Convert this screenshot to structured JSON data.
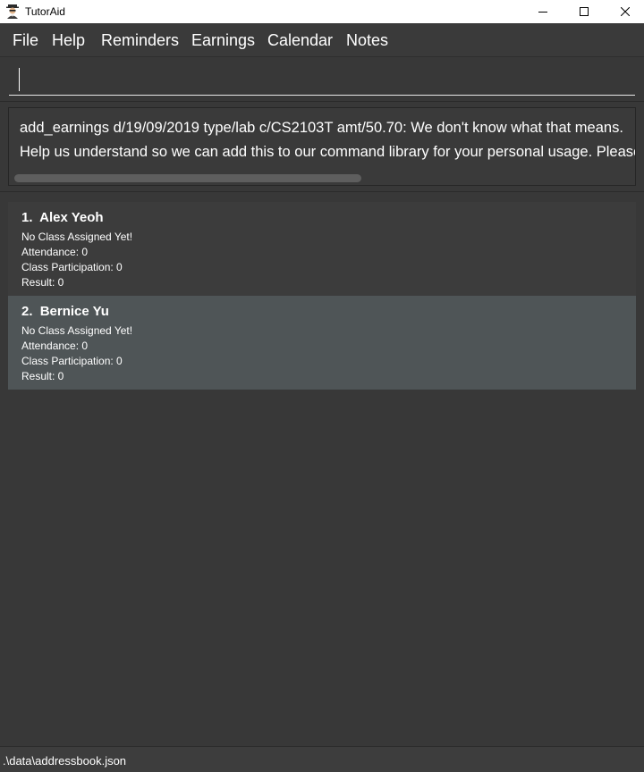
{
  "window": {
    "title": "TutorAid",
    "icon": "tutor-avatar-icon",
    "controls": [
      "minimize-icon",
      "maximize-icon",
      "close-icon"
    ]
  },
  "menu": {
    "items": [
      {
        "label": "File"
      },
      {
        "label": "Help"
      },
      {
        "label": "Reminders"
      },
      {
        "label": "Earnings"
      },
      {
        "label": "Calendar"
      },
      {
        "label": "Notes"
      }
    ]
  },
  "command": {
    "value": "",
    "placeholder": ""
  },
  "result": {
    "line1": "add_earnings d/19/09/2019 type/lab c/CS2103T amt/50.70: We don't know what that means.",
    "line2": "Help us understand so we can add this to our command library for your personal usage. Please"
  },
  "persons": [
    {
      "index": "1.",
      "name": "Alex Yeoh",
      "class_status": "No Class Assigned Yet!",
      "attendance": "Attendance: 0",
      "participation": "Class Participation: 0",
      "result": "Result: 0"
    },
    {
      "index": "2.",
      "name": "Bernice Yu",
      "class_status": "No Class Assigned Yet!",
      "attendance": "Attendance: 0",
      "participation": "Class Participation: 0",
      "result": "Result: 0"
    }
  ],
  "status": {
    "path": ".\\data\\addressbook.json"
  },
  "colors": {
    "background": "#383838",
    "selected_card": "#4f5557",
    "text": "#ffffff"
  }
}
